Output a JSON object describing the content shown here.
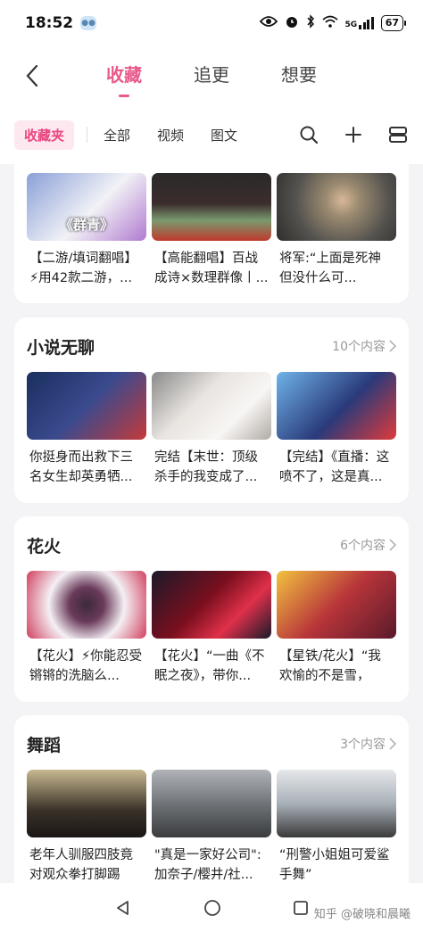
{
  "status_bar": {
    "time": "18:52",
    "network": "5G",
    "battery": "67"
  },
  "header": {
    "tabs": [
      "收藏",
      "追更",
      "想要"
    ],
    "active_tab": "收藏"
  },
  "filter_bar": {
    "chip": "收藏夹",
    "filters": [
      "全部",
      "视频",
      "图文"
    ]
  },
  "top_row": {
    "items": [
      {
        "caption": "【二游/填词翻唱】⚡用42款二游，...",
        "thumb_text": "《群青》",
        "colors": [
          "#8aa0d8",
          "#f2f2f6"
        ]
      },
      {
        "caption": "【高能翻唱】百战成诗×数理群像丨...",
        "thumb_text": "",
        "colors": [
          "#2a2a2a",
          "#c0392b"
        ]
      },
      {
        "caption": "将军:“上面是死神 但没什么可...",
        "thumb_text": "",
        "colors": [
          "#55534f",
          "#9a8a70"
        ]
      }
    ]
  },
  "collections": [
    {
      "title": "小说无聊",
      "count": "10个内容",
      "items": [
        {
          "caption": "你挺身而出救下三名女生却英勇牺...",
          "colors": [
            "#1a2f5e",
            "#c43a3a"
          ]
        },
        {
          "caption": "完结【末世：顶级杀手的我变成了...",
          "colors": [
            "#e8e4e0",
            "#8a8a8a"
          ]
        },
        {
          "caption": "【完结】《直播：这喷不了，这是真...",
          "colors": [
            "#2a3a7a",
            "#6fb3e8"
          ]
        }
      ]
    },
    {
      "title": "花火",
      "count": "6个内容",
      "items": [
        {
          "caption": "【花火】⚡你能忍受锵锵的洗脑么...",
          "colors": [
            "#f4f0f4",
            "#d14060"
          ]
        },
        {
          "caption": "【花火】“一曲《不眠之夜》，带你...",
          "colors": [
            "#7a0f1e",
            "#1a1a2a"
          ]
        },
        {
          "caption": "【星铁/花火】“我欢愉的不是雪，是...",
          "colors": [
            "#b8353a",
            "#f2c340"
          ]
        }
      ]
    },
    {
      "title": "舞蹈",
      "count": "3个内容",
      "items": [
        {
          "caption": "老年人驯服四肢竟对观众拳打脚踢",
          "colors": [
            "#3a3228",
            "#c8b890"
          ]
        },
        {
          "caption": "\"真是一家好公司\": 加奈子/樱井/社...",
          "colors": [
            "#6a6e72",
            "#b0b4b8"
          ]
        },
        {
          "caption": "“刑警小姐姐可爱鲨手舞”",
          "colors": [
            "#a8b0b8",
            "#e6e8ea"
          ]
        }
      ]
    }
  ],
  "watermark": "知乎 @破晓和晨曦"
}
